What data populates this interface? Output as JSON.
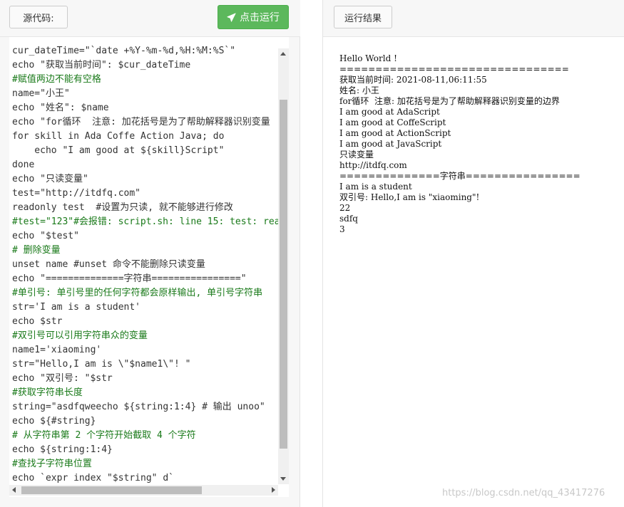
{
  "left_toolbar": {
    "source_label": "源代码:",
    "run_label": "点击运行"
  },
  "right_toolbar": {
    "result_label": "运行结果"
  },
  "code_lines": [
    {
      "text": "cur_dateTime=\"`date +%Y-%m-%d,%H:%M:%S`\"",
      "green": false
    },
    {
      "text": "echo \"获取当前时间\": $cur_dateTime",
      "green": false
    },
    {
      "text": "#赋值两边不能有空格",
      "green": true
    },
    {
      "text": "name=\"小王\"",
      "green": false
    },
    {
      "text": "echo \"姓名\": $name",
      "green": false
    },
    {
      "text": "echo \"for循环  注意: 加花括号是为了帮助解释器识别变量",
      "green": false
    },
    {
      "text": "for skill in Ada Coffe Action Java; do",
      "green": false
    },
    {
      "text": "    echo \"I am good at ${skill}Script\"",
      "green": false
    },
    {
      "text": "done",
      "green": false
    },
    {
      "text": "echo \"只读变量\"",
      "green": false
    },
    {
      "text": "test=\"http://itdfq.com\"",
      "green": false
    },
    {
      "text": "readonly test  #设置为只读, 就不能够进行修改",
      "green": false
    },
    {
      "text": "#test=\"123\"#会报错: script.sh: line 15: test: rea",
      "green": true
    },
    {
      "text": "echo \"$test\"",
      "green": false
    },
    {
      "text": "# 删除变量",
      "green": true
    },
    {
      "text": "unset name #unset 命令不能删除只读变量",
      "green": false
    },
    {
      "text": "echo \"==============字符串================\"",
      "green": false
    },
    {
      "text": "#单引号: 单引号里的任何字符都会原样输出, 单引号字符串",
      "green": true
    },
    {
      "text": "str='I am is a student'",
      "green": false
    },
    {
      "text": "echo $str",
      "green": false
    },
    {
      "text": "#双引号可以引用字符串众的变量",
      "green": true
    },
    {
      "text": "name1='xiaoming'",
      "green": false
    },
    {
      "text": "str=\"Hello,I am is \\\"$name1\\\"! \"",
      "green": false
    },
    {
      "text": "echo \"双引号: \"$str",
      "green": false
    },
    {
      "text": "#获取字符串长度",
      "green": true
    },
    {
      "text": "string=\"asdfqweecho ${string:1:4} # 输出 unoo\"",
      "green": false
    },
    {
      "text": "echo ${#string}",
      "green": false
    },
    {
      "text": "# 从字符串第 2 个字符开始截取 4 个字符",
      "green": true
    },
    {
      "text": "echo ${string:1:4}",
      "green": false
    },
    {
      "text": "#查找子字符串位置",
      "green": true
    },
    {
      "text": "echo `expr index \"$string\" d`",
      "green": false
    }
  ],
  "output_lines": [
    "Hello World !",
    "================================",
    "获取当前时间: 2021-08-11,06:11:55",
    "姓名: 小王",
    "for循环  注意: 加花括号是为了帮助解释器识别变量的边界",
    "I am good at AdaScript",
    "I am good at CoffeScript",
    "I am good at ActionScript",
    "I am good at JavaScript",
    "只读变量",
    "http://itdfq.com",
    "==============字符串================",
    "I am is a student",
    "双引号: Hello,I am is \"xiaoming\"!",
    "22",
    "sdfq",
    "3"
  ],
  "watermark": "https://blog.csdn.net/qq_43417276",
  "colors": {
    "run_button": "#5cb85c",
    "comment_green": "#1a7a1a"
  },
  "icons": {
    "run": "paper-plane-icon"
  }
}
